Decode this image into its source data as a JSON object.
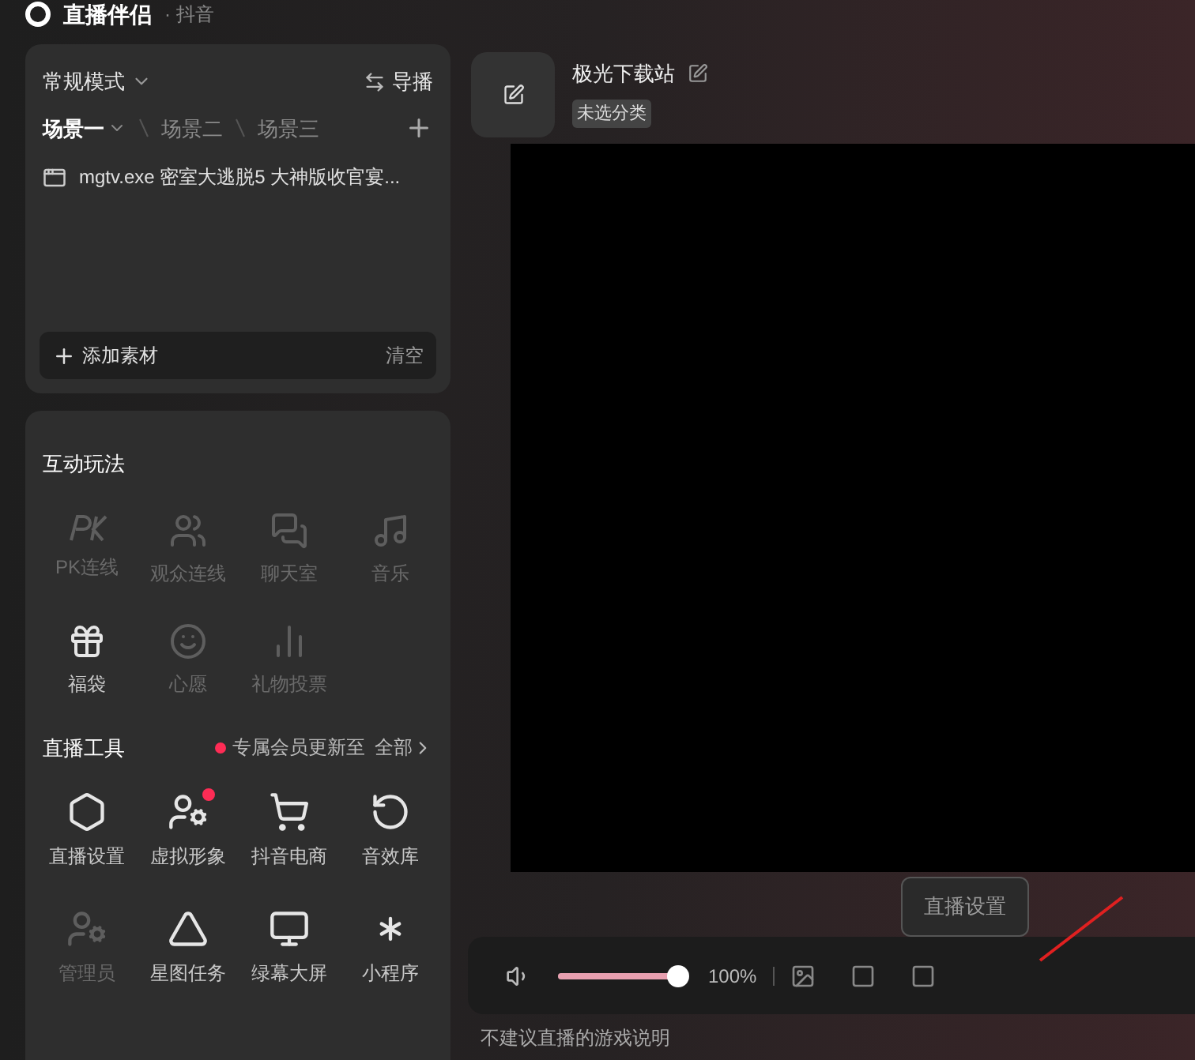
{
  "app": {
    "title": "直播伴侣",
    "platform": "· 抖音"
  },
  "scene_panel": {
    "mode": "常规模式",
    "director": "导播",
    "scenes": [
      {
        "label": "场景一",
        "selected": true
      },
      {
        "label": "场景二",
        "selected": false
      },
      {
        "label": "场景三",
        "selected": false
      }
    ],
    "sources": [
      "mgtv.exe 密室大逃脱5 大神版收官宴..."
    ],
    "add": "添加素材",
    "clear": "清空"
  },
  "interactive": {
    "title": "互动玩法",
    "items": [
      {
        "label": "PK连线",
        "disabled": true
      },
      {
        "label": "观众连线",
        "disabled": true
      },
      {
        "label": "聊天室",
        "disabled": true
      },
      {
        "label": "音乐",
        "disabled": true
      },
      {
        "label": "福袋",
        "disabled": false
      },
      {
        "label": "心愿",
        "disabled": true
      },
      {
        "label": "礼物投票",
        "disabled": true
      }
    ]
  },
  "tools": {
    "title": "直播工具",
    "notice": "专属会员更新至",
    "all": "全部",
    "items": [
      {
        "label": "直播设置",
        "disabled": false,
        "badge": false
      },
      {
        "label": "虚拟形象",
        "disabled": false,
        "badge": true
      },
      {
        "label": "抖音电商",
        "disabled": false,
        "badge": false
      },
      {
        "label": "音效库",
        "disabled": false,
        "badge": false
      },
      {
        "label": "管理员",
        "disabled": true,
        "badge": false
      },
      {
        "label": "星图任务",
        "disabled": false,
        "badge": false
      },
      {
        "label": "绿幕大屏",
        "disabled": false,
        "badge": false
      },
      {
        "label": "小程序",
        "disabled": false,
        "badge": false
      }
    ]
  },
  "room": {
    "title": "极光下载站",
    "category": "未选分类"
  },
  "tooltip": "直播设置",
  "volume": {
    "level": 1,
    "reading": "100%"
  },
  "footer_note": "不建议直播的游戏说明"
}
